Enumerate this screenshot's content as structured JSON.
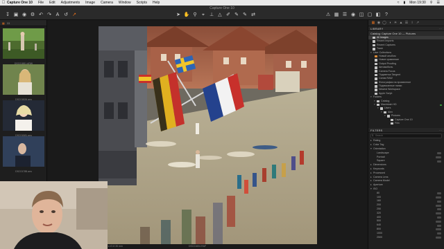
{
  "menubar": {
    "app_name": "Capture One 10",
    "items": [
      "File",
      "Edit",
      "Adjustments",
      "Image",
      "Camera",
      "Window",
      "Scripts",
      "Help"
    ],
    "clock": "Mon 19:30"
  },
  "window": {
    "title": "Capture One 10"
  },
  "browser": {
    "count_label": "33",
    "thumbnails": [
      {
        "caption": "DSC01881.ARW",
        "tint": "#5c7a3c"
      },
      {
        "caption": "DSC01826.arw",
        "tint": "#7b8a5a"
      },
      {
        "caption": "DSC01581.arw",
        "tint": "#2b3140"
      },
      {
        "caption": "DSC01788.arw",
        "tint": "#2c3652"
      }
    ]
  },
  "viewer": {
    "filename": "DSC01604.RAF",
    "status_left": "1/1600 s  f/2.8  35 mm",
    "status_right": ""
  },
  "library": {
    "panel_title": "LIBRARY",
    "catalog_label": "Catalog: Capture One 10 — Pictures",
    "collections": [
      {
        "label": "All Images",
        "selected": true,
        "icon": "grid"
      },
      {
        "label": "Recent Imports",
        "icon": "folder"
      },
      {
        "label": "Recent Captures",
        "icon": "folder"
      },
      {
        "label": "Trash",
        "icon": "trash"
      }
    ],
    "user_collections_title": "User Collections",
    "user_collections": [
      "Новый альбом",
      "Новое сравнение",
      "Output Proofing",
      "Автомобиль",
      "Camera Focus",
      "Подсветка Tangent",
      "Синяя RAW",
      "Фотография на проявление",
      "Подписанные папки",
      "Newest Workspace",
      "Apple Script"
    ],
    "folders_title": "Folders",
    "folders": [
      {
        "label": "Catalog",
        "depth": 1
      },
      {
        "label": "Macintosh HD",
        "depth": 1,
        "status": "online"
      },
      {
        "label": "Users",
        "depth": 2
      },
      {
        "label": "Alex",
        "depth": 3
      },
      {
        "label": "Pictures",
        "depth": 4
      },
      {
        "label": "Capture One 10",
        "depth": 5
      },
      {
        "label": "Film",
        "depth": 5
      }
    ]
  },
  "filters": {
    "title": "FILTERS",
    "search_placeholder": "Search",
    "rows": [
      {
        "label": "Rating",
        "expanded": false
      },
      {
        "label": "Color Tag",
        "expanded": false
      },
      {
        "label": "Orientation",
        "expanded": true
      },
      {
        "label": "Landscape",
        "sub": true
      },
      {
        "label": "Portrait",
        "sub": true
      },
      {
        "label": "Square",
        "sub": true
      },
      {
        "label": "Dimensions",
        "expanded": false
      },
      {
        "label": "Keywords",
        "expanded": false
      },
      {
        "label": "Processed",
        "expanded": false
      },
      {
        "label": "Camera Lens",
        "expanded": false
      },
      {
        "label": "Camera Model",
        "expanded": false
      },
      {
        "label": "Aperture",
        "expanded": false
      },
      {
        "label": "ISO",
        "expanded": true
      },
      {
        "label": "80",
        "sub": true
      },
      {
        "label": "100",
        "sub": true
      },
      {
        "label": "160",
        "sub": true
      },
      {
        "label": "200",
        "sub": true
      },
      {
        "label": "250",
        "sub": true
      },
      {
        "label": "320",
        "sub": true
      },
      {
        "label": "400",
        "sub": true
      },
      {
        "label": "500",
        "sub": true
      },
      {
        "label": "640",
        "sub": true
      },
      {
        "label": "800",
        "sub": true
      },
      {
        "label": "1000",
        "sub": true
      },
      {
        "label": "2500",
        "sub": true
      }
    ]
  },
  "colors": {
    "accent": "#e8711c",
    "panel": "#1f1f1f"
  }
}
